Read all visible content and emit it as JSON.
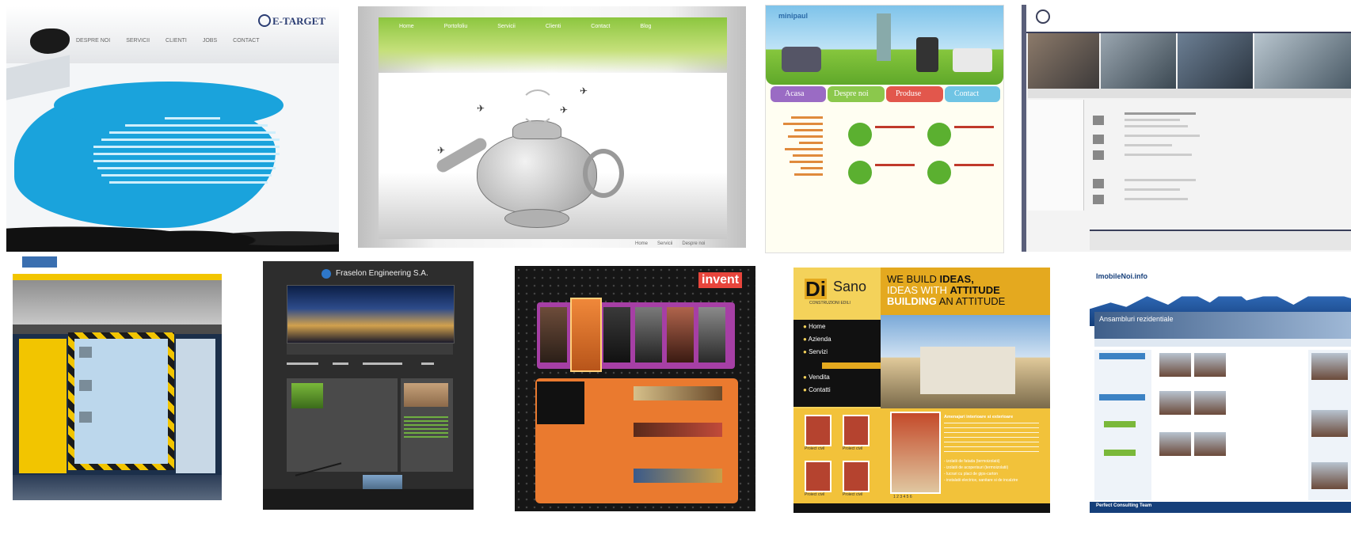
{
  "etarget": {
    "logo": "E-TARGET",
    "nav": [
      "DESPRE NOI",
      "SERVICII",
      "CLIENTI",
      "JOBS",
      "CONTACT"
    ]
  },
  "teapot": {
    "nav": [
      "Home",
      "Portofoliu",
      "Servicii",
      "Clienti",
      "Contact",
      "Blog"
    ],
    "footer": [
      "Home",
      "Servicii",
      "Despre noi"
    ]
  },
  "kids": {
    "logo": "minipaul",
    "tabs": [
      "Acasa",
      "Despre noi",
      "Produse",
      "Contact"
    ]
  },
  "fraselon": {
    "brand": "Fraselon Engineering S.A."
  },
  "invent": {
    "logo": "invent"
  },
  "disano": {
    "logo_mark": "Di",
    "logo_name": "Sano",
    "logo_sub": "CONSTRUZIONI  EDILI",
    "slogan_l1a": "WE BUILD ",
    "slogan_l1b": "IDEAS,",
    "slogan_l2a": "IDEAS WITH ",
    "slogan_l2b": "ATTITUDE",
    "slogan_l3a": "BUILDING",
    "slogan_l3b": " AN ATTITUDE",
    "menu": [
      "Home",
      "Azienda",
      "Servizi",
      "Vendita",
      "Contatti"
    ],
    "tile_labels": [
      "Proiect civil",
      "Proiect civil",
      "Proiect civil",
      "Proiect civil"
    ],
    "content_title": "Amenajari interioare si exterioare",
    "bullets": [
      "- izolatii de fatada (termoizolatii)",
      "- izolatii de acoperisuri (termoizolatii)",
      "- lucrari cu placi de gips-carton",
      "- instalatii electrice, sanitare si de incalzire"
    ],
    "pages": "1 2 3 4 5 6"
  },
  "imobile": {
    "logo": "ImobileNoi.info",
    "banner": "Ansambluri rezidentiale",
    "footer": "Perfect Consulting Team"
  }
}
